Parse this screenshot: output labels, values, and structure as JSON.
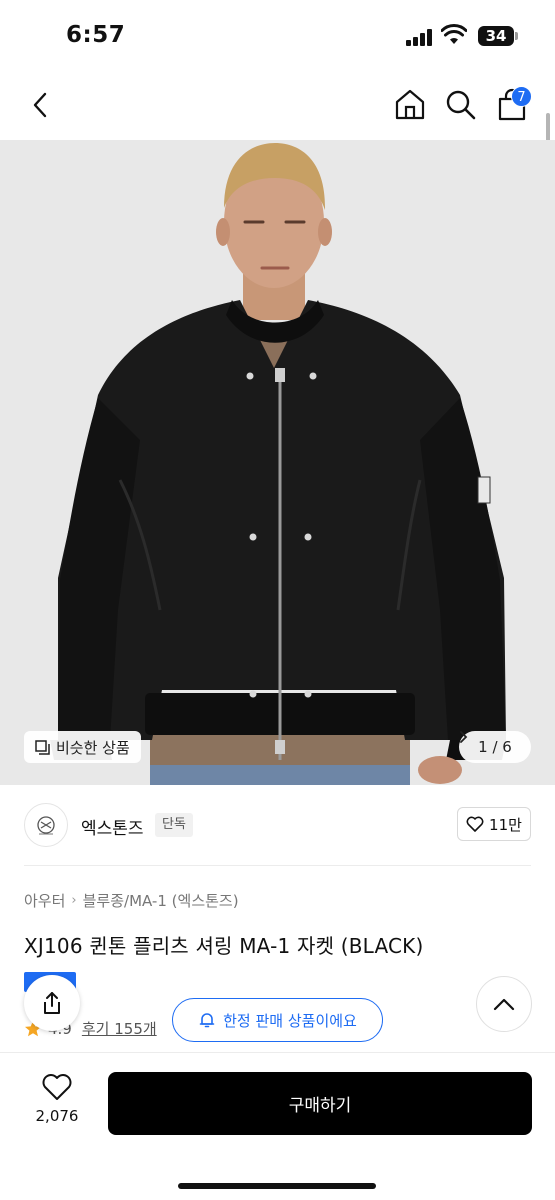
{
  "status": {
    "time": "6:57",
    "battery": "34"
  },
  "nav": {
    "back_icon": "chevron-left-icon",
    "home_icon": "home-icon",
    "search_icon": "search-icon",
    "cart_icon": "shopping-bag-icon",
    "cart_badge": "7"
  },
  "gallery": {
    "similar_label": "비슷한 상품",
    "pager": "1 / 6"
  },
  "brand": {
    "name": "엑스톤즈",
    "tag": "단독",
    "like_count": "11만"
  },
  "product": {
    "breadcrumb": [
      "아우터",
      "블루종/MA-1 (엑스톤즈)"
    ],
    "title": "XJ106 퀸톤 플리츠 셔링 MA-1 자켓 (BLACK)",
    "rating": "4.9",
    "review": "후기 155개",
    "limited_label": "한정 판매 상품이에요"
  },
  "bottom": {
    "wish_count": "2,076",
    "buy_label": "구매하기"
  },
  "colors": {
    "accent": "#1e6cf3",
    "buy_button": "#000000",
    "star": "#f5a623"
  }
}
